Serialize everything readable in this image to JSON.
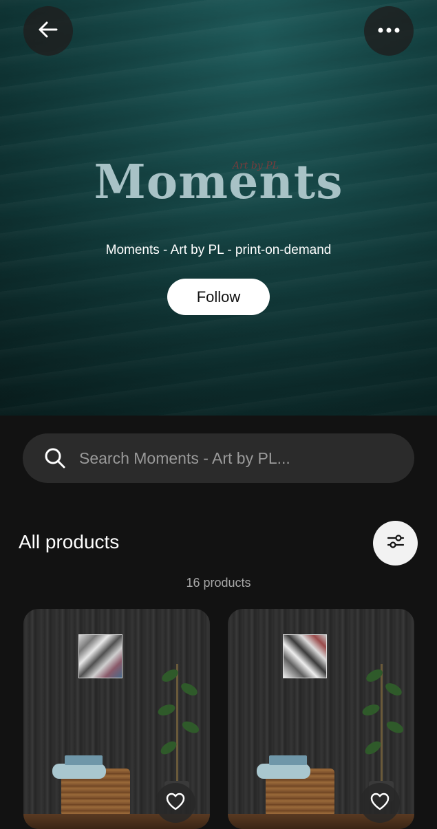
{
  "header": {
    "back_icon": "arrow-left-icon",
    "more_icon": "more-horizontal-icon"
  },
  "shop": {
    "logo_text": "Moments",
    "logo_subtext": "Art by PL",
    "tagline": "Moments - Art by PL - print-on-demand",
    "follow_label": "Follow"
  },
  "search": {
    "placeholder": "Search Moments - Art by PL..."
  },
  "products": {
    "section_title": "All products",
    "count_label": "16 products",
    "filter_icon": "sliders-icon",
    "items": [
      {
        "favorite_icon": "heart-outline-icon"
      },
      {
        "favorite_icon": "heart-outline-icon"
      }
    ]
  },
  "colors": {
    "background": "#121212",
    "hero_teal": "#164646",
    "search_bg": "#2b2b2b",
    "follow_bg": "#ffffff"
  }
}
